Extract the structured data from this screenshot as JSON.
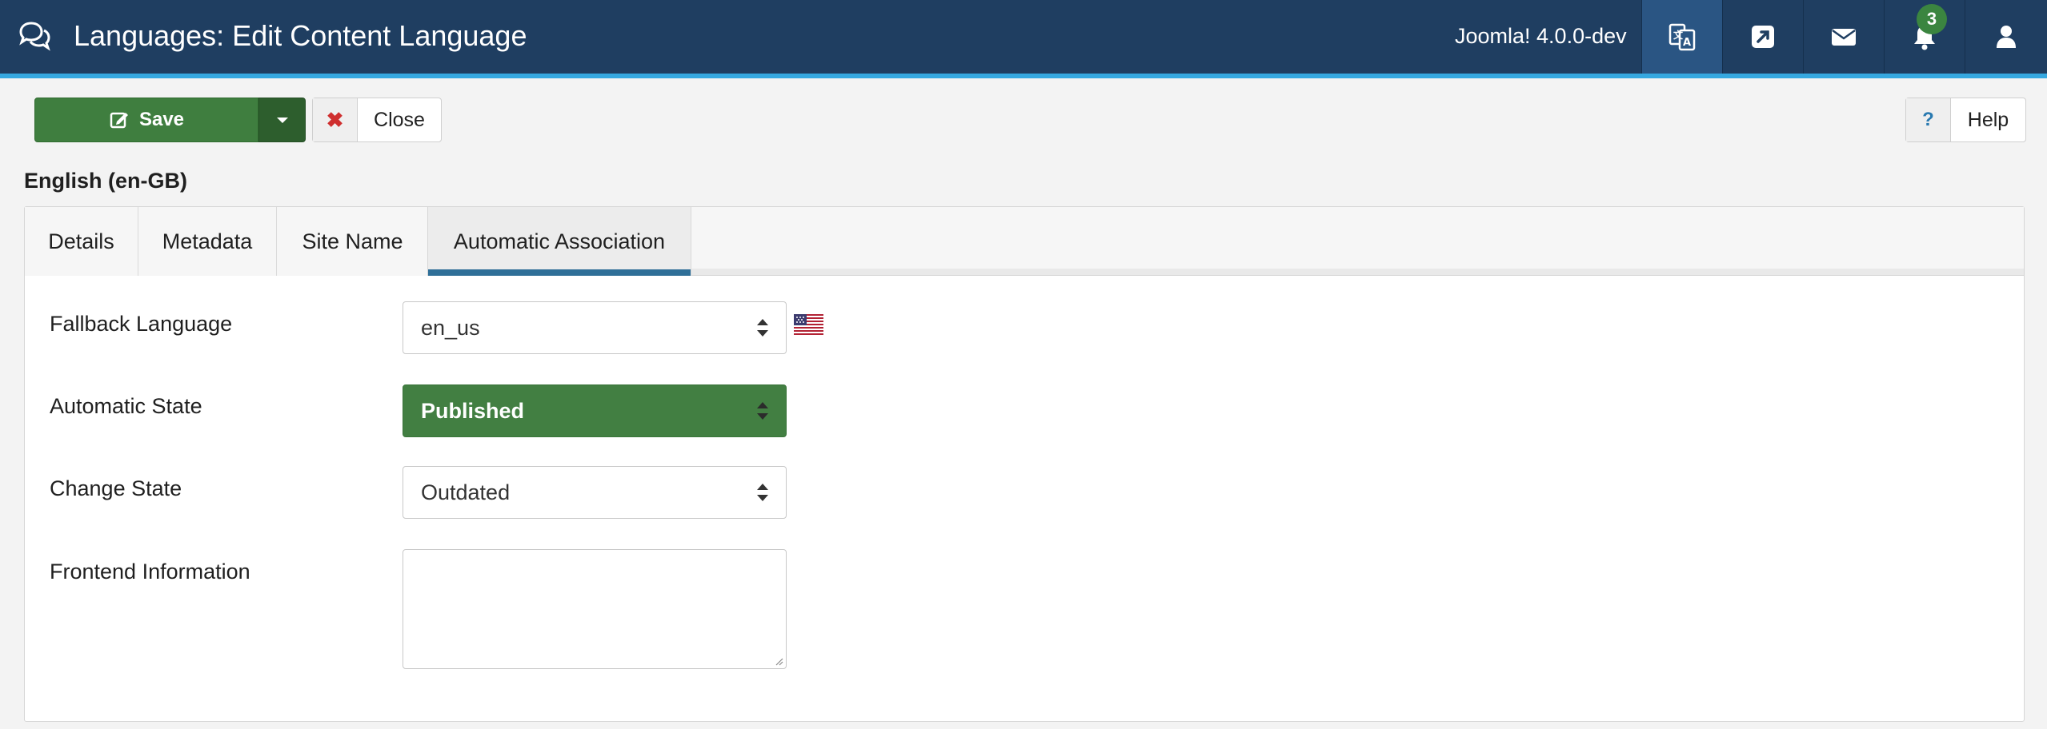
{
  "header": {
    "title": "Languages: Edit Content Language",
    "version": "Joomla! 4.0.0-dev",
    "notifications_count": "3",
    "icons": [
      "language-icon",
      "external-link-icon",
      "mail-icon",
      "bell-icon",
      "user-icon"
    ]
  },
  "toolbar": {
    "save_label": "Save",
    "close_label": "Close",
    "close_icon": "✖",
    "help_label": "Help",
    "help_icon": "?"
  },
  "section": {
    "title": "English (en-GB)"
  },
  "tabs": [
    {
      "label": "Details",
      "active": false
    },
    {
      "label": "Metadata",
      "active": false
    },
    {
      "label": "Site Name",
      "active": false
    },
    {
      "label": "Automatic Association",
      "active": true
    }
  ],
  "form": {
    "fallback_language": {
      "label": "Fallback Language",
      "value": "en_us",
      "flag": "us-flag-icon"
    },
    "automatic_state": {
      "label": "Automatic State",
      "value": "Published"
    },
    "change_state": {
      "label": "Change State",
      "value": "Outdated"
    },
    "frontend_information": {
      "label": "Frontend Information",
      "value": ""
    }
  },
  "colors": {
    "header_bg": "#1f3e61",
    "accent": "#35a8e0",
    "success": "#3f7e3f",
    "tab_active": "#2f6f98",
    "badge": "#3b8540"
  }
}
